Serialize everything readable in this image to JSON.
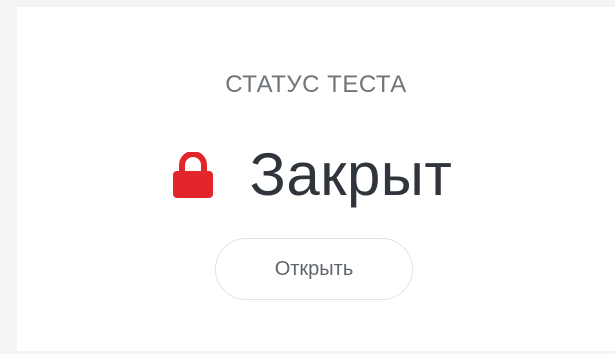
{
  "card": {
    "status_heading": "СТАТУС ТЕСТА",
    "status_value": "Закрыт",
    "status_icon": "lock-icon",
    "status_icon_color": "#e3262b",
    "open_button_label": "Открыть"
  }
}
